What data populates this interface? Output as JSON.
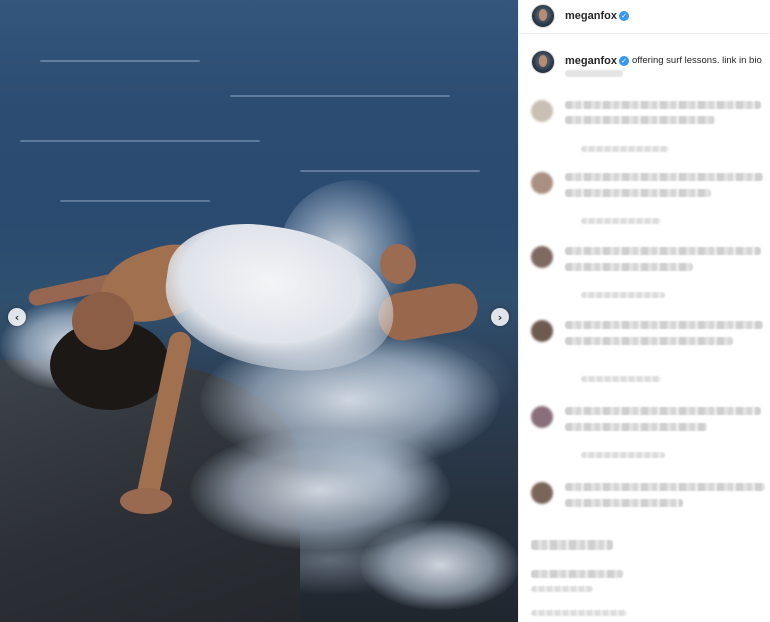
{
  "post": {
    "media": {
      "description_icon": "photo",
      "prev_icon": "chevron-left-icon",
      "next_icon": "chevron-right-icon",
      "prev_glyph": "‹",
      "next_glyph": "›"
    },
    "header": {
      "username": "meganfox",
      "verified_glyph": "✓"
    },
    "caption": {
      "username": "meganfox",
      "verified_glyph": "✓",
      "text": "offering surf lessons. link in bio"
    }
  },
  "colors": {
    "verified_badge": "#3897f0",
    "text": "#262626",
    "border": "#efefef"
  }
}
